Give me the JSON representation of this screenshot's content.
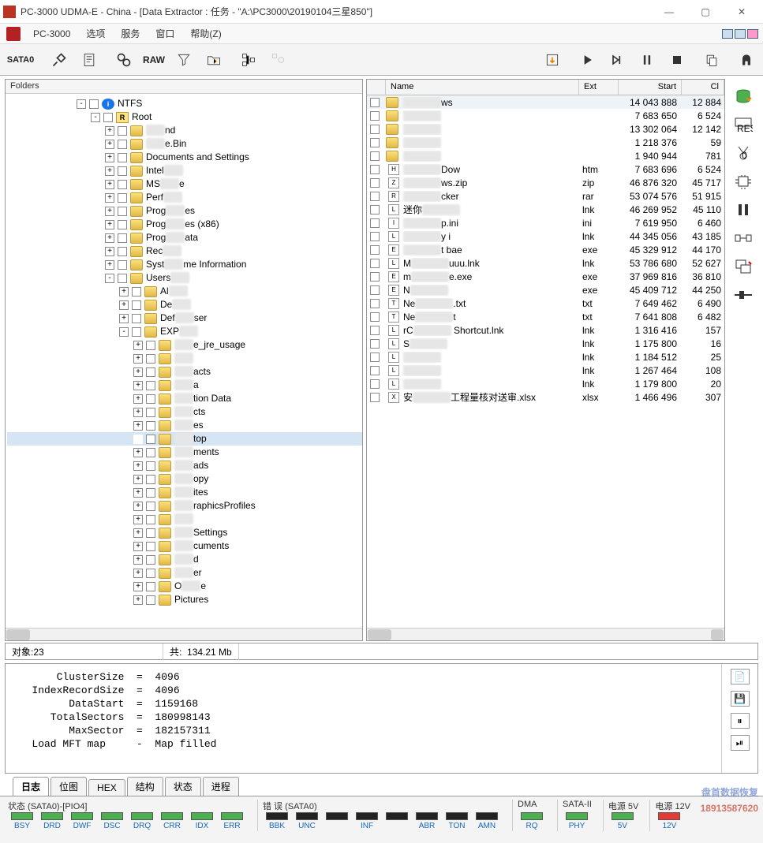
{
  "title": "PC-3000 UDMA-E - China - [Data Extractor : 任务 - \"A:\\PC3000\\20190104三星850\"]",
  "menu": {
    "app": "PC-3000",
    "items": [
      "选项",
      "服务",
      "窗口",
      "帮助(Z)"
    ]
  },
  "toolbar": {
    "sata": "SATA0",
    "raw": "RAW"
  },
  "left": {
    "header": "Folders"
  },
  "tree": [
    {
      "depth": 0,
      "exp": "-",
      "icon": "drive",
      "text": "NTFS"
    },
    {
      "depth": 1,
      "exp": "-",
      "icon": "r",
      "text": "Root"
    },
    {
      "depth": 2,
      "exp": "+",
      "icon": "folder",
      "text": "",
      "blur": "nd"
    },
    {
      "depth": 2,
      "exp": "+",
      "icon": "folder",
      "text": "",
      "blur": "e.Bin"
    },
    {
      "depth": 2,
      "exp": "+",
      "icon": "folder",
      "text": "Documents and Settings"
    },
    {
      "depth": 2,
      "exp": "+",
      "icon": "folder",
      "text": "Intel",
      "blur": ""
    },
    {
      "depth": 2,
      "exp": "+",
      "icon": "folder",
      "text": "MS",
      "blur": "e"
    },
    {
      "depth": 2,
      "exp": "+",
      "icon": "folder",
      "text": "Perf",
      "blur": ""
    },
    {
      "depth": 2,
      "exp": "+",
      "icon": "folder",
      "text": "Prog",
      "blur": "es"
    },
    {
      "depth": 2,
      "exp": "+",
      "icon": "folder",
      "text": "Prog",
      "blur": "es (x86)"
    },
    {
      "depth": 2,
      "exp": "+",
      "icon": "folder",
      "text": "Prog",
      "blur": "ata"
    },
    {
      "depth": 2,
      "exp": "+",
      "icon": "folder",
      "text": "Rec",
      "blur": ""
    },
    {
      "depth": 2,
      "exp": "+",
      "icon": "folder",
      "text": "Syst",
      "blur": "me Information"
    },
    {
      "depth": 2,
      "exp": "-",
      "icon": "folder",
      "text": "Users",
      "blur": ""
    },
    {
      "depth": 3,
      "exp": "+",
      "icon": "folder",
      "text": "Al",
      "blur": ""
    },
    {
      "depth": 3,
      "exp": "+",
      "icon": "folder",
      "text": "De",
      "blur": ""
    },
    {
      "depth": 3,
      "exp": "+",
      "icon": "folder",
      "text": "Def",
      "blur": "ser"
    },
    {
      "depth": 3,
      "exp": "-",
      "icon": "folder",
      "text": "EXP",
      "blur": ""
    },
    {
      "depth": 4,
      "exp": "+",
      "icon": "folder",
      "text": "",
      "blur": "e_jre_usage"
    },
    {
      "depth": 4,
      "exp": "+",
      "icon": "folder",
      "text": "",
      "blur": ""
    },
    {
      "depth": 4,
      "exp": "+",
      "icon": "folder",
      "text": "",
      "blur": "acts"
    },
    {
      "depth": 4,
      "exp": "+",
      "icon": "folder",
      "text": "",
      "blur": "a"
    },
    {
      "depth": 4,
      "exp": "+",
      "icon": "folder",
      "text": "",
      "blur": "tion Data"
    },
    {
      "depth": 4,
      "exp": "+",
      "icon": "folder",
      "text": "",
      "blur": "cts"
    },
    {
      "depth": 4,
      "exp": "+",
      "icon": "folder",
      "text": "",
      "blur": "es"
    },
    {
      "depth": 4,
      "exp": "",
      "icon": "folder",
      "text": "",
      "blur": "top",
      "sel": true
    },
    {
      "depth": 4,
      "exp": "+",
      "icon": "folder",
      "text": "",
      "blur": "ments"
    },
    {
      "depth": 4,
      "exp": "+",
      "icon": "folder",
      "text": "",
      "blur": "ads"
    },
    {
      "depth": 4,
      "exp": "+",
      "icon": "folder",
      "text": "",
      "blur": "opy"
    },
    {
      "depth": 4,
      "exp": "+",
      "icon": "folder",
      "text": "",
      "blur": "ites"
    },
    {
      "depth": 4,
      "exp": "+",
      "icon": "folder",
      "text": "",
      "blur": "raphicsProfiles"
    },
    {
      "depth": 4,
      "exp": "+",
      "icon": "folder",
      "text": "",
      "blur": ""
    },
    {
      "depth": 4,
      "exp": "+",
      "icon": "folder",
      "text": "",
      "blur": "Settings"
    },
    {
      "depth": 4,
      "exp": "+",
      "icon": "folder",
      "text": "",
      "blur": "cuments"
    },
    {
      "depth": 4,
      "exp": "+",
      "icon": "folder",
      "text": "",
      "blur": "d"
    },
    {
      "depth": 4,
      "exp": "+",
      "icon": "folder",
      "text": "",
      "blur": "er"
    },
    {
      "depth": 4,
      "exp": "+",
      "icon": "folder",
      "text": "O",
      "blur": "e"
    },
    {
      "depth": 4,
      "exp": "+",
      "icon": "folder",
      "text": "Pictures"
    }
  ],
  "files": {
    "headers": {
      "name": "Name",
      "ext": "Ext",
      "start": "Start",
      "cl": "Cl"
    },
    "rows": [
      {
        "icon": "folder",
        "name": "",
        "blur": "ws",
        "ext": "",
        "start": "14 043 888",
        "cl": "12 884"
      },
      {
        "icon": "folder",
        "name": "",
        "blur": "",
        "ext": "",
        "start": "7 683 650",
        "cl": "6 524"
      },
      {
        "icon": "folder",
        "name": "",
        "blur": "",
        "ext": "",
        "start": "13 302 064",
        "cl": "12 142"
      },
      {
        "icon": "folder",
        "name": "",
        "blur": "",
        "ext": "",
        "start": "1 218 376",
        "cl": "59"
      },
      {
        "icon": "folder",
        "name": "",
        "blur": "",
        "ext": "",
        "start": "1 940 944",
        "cl": "781"
      },
      {
        "icon": "htm",
        "name": "",
        "blur": "Dow",
        "ext": "htm",
        "start": "7 683 696",
        "cl": "6 524"
      },
      {
        "icon": "zip",
        "name": "",
        "blur": "5.04",
        "suffix": "ws.zip",
        "ext": "zip",
        "start": "46 876 320",
        "cl": "45 717"
      },
      {
        "icon": "rar",
        "name": "",
        "blur": "cker",
        "ext": "rar",
        "start": "53 074 576",
        "cl": "51 915"
      },
      {
        "icon": "lnk",
        "name": "迷你",
        "blur": "",
        "ext": "lnk",
        "start": "46 269 952",
        "cl": "45 110"
      },
      {
        "icon": "ini",
        "name": "",
        "blur": "p.ini",
        "ext": "ini",
        "start": "7 619 950",
        "cl": "6 460"
      },
      {
        "icon": "lnk",
        "name": "",
        "blur": "y i",
        "ext": "lnk",
        "start": "44 345 056",
        "cl": "43 185"
      },
      {
        "icon": "exe",
        "name": "",
        "blur": "t bae",
        "ext": "exe",
        "start": "45 329 912",
        "cl": "44 170"
      },
      {
        "icon": "lnk",
        "name": "M",
        "blur": "uuu.lnk",
        "ext": "lnk",
        "start": "53 786 680",
        "cl": "52 627"
      },
      {
        "icon": "exe",
        "name": "m",
        "blur": "e.exe",
        "ext": "exe",
        "start": "37 969 816",
        "cl": "36 810"
      },
      {
        "icon": "exe",
        "name": "N",
        "blur": "",
        "ext": "exe",
        "start": "45 409 712",
        "cl": "44 250"
      },
      {
        "icon": "txt",
        "name": "Ne",
        "blur": "D",
        "suffix": ".txt",
        "ext": "txt",
        "start": "7 649 462",
        "cl": "6 490"
      },
      {
        "icon": "txt",
        "name": "Ne",
        "blur": "Docu",
        "suffix": "t",
        "ext": "txt",
        "start": "7 641 808",
        "cl": "6 482"
      },
      {
        "icon": "lnk",
        "name": "rC",
        "blur": " Shortcut.lnk",
        "ext": "lnk",
        "start": "1 316 416",
        "cl": "157"
      },
      {
        "icon": "lnk",
        "name": "S",
        "blur": "",
        "ext": "lnk",
        "start": "1 175 800",
        "cl": "16"
      },
      {
        "icon": "lnk",
        "name": "",
        "blur": "",
        "ext": "lnk",
        "start": "1 184 512",
        "cl": "25"
      },
      {
        "icon": "lnk",
        "name": "",
        "blur": "",
        "ext": "lnk",
        "start": "1 267 464",
        "cl": "108"
      },
      {
        "icon": "lnk",
        "name": "",
        "blur": "",
        "ext": "lnk",
        "start": "1 179 800",
        "cl": "20"
      },
      {
        "icon": "xlsx",
        "name": "安",
        "blur": "",
        "suffix": "工程量核对送审.xlsx",
        "ext": "xlsx",
        "start": "1 466 496",
        "cl": "307"
      }
    ]
  },
  "status": {
    "count_label": "对象:",
    "count": "23",
    "size_label": "共:",
    "size": "134.21 Mb"
  },
  "log": "       ClusterSize  =  4096\n   IndexRecordSize  =  4096\n         DataStart  =  1159168\n      TotalSectors  =  180998143\n         MaxSector  =  182157311\n   Load MFT map     -  Map filled",
  "watermark": {
    "line1": "盘首数据恢复",
    "line2": "18913587620"
  },
  "tabs": [
    "日志",
    "位图",
    "HEX",
    "结构",
    "状态",
    "进程"
  ],
  "bottom": {
    "g1": {
      "label": "状态 (SATA0)-[PIO4]",
      "leds": [
        {
          "name": "BSY",
          "on": true
        },
        {
          "name": "DRD",
          "on": true
        },
        {
          "name": "DWF",
          "on": true
        },
        {
          "name": "DSC",
          "on": true
        },
        {
          "name": "DRQ",
          "on": true
        },
        {
          "name": "CRR",
          "on": true
        },
        {
          "name": "IDX",
          "on": true
        },
        {
          "name": "ERR",
          "on": true
        }
      ]
    },
    "g2": {
      "label": "错 误 (SATA0)",
      "leds": [
        {
          "name": "BBK",
          "on": false
        },
        {
          "name": "UNC",
          "on": false
        },
        {
          "name": "",
          "on": false
        },
        {
          "name": "INF",
          "on": false
        },
        {
          "name": "",
          "on": false
        },
        {
          "name": "ABR",
          "on": false
        },
        {
          "name": "TON",
          "on": false
        },
        {
          "name": "AMN",
          "on": false
        }
      ]
    },
    "g3": {
      "label": "DMA",
      "leds": [
        {
          "name": "RQ",
          "on": true
        }
      ]
    },
    "g4": {
      "label": "SATA-II",
      "leds": [
        {
          "name": "PHY",
          "on": true
        }
      ]
    },
    "g5": {
      "label": "电源 5V",
      "leds": [
        {
          "name": "5V",
          "on": true
        }
      ]
    },
    "g6": {
      "label": "电源 12V",
      "leds": [
        {
          "name": "12V",
          "on": true,
          "red": true
        }
      ]
    }
  }
}
